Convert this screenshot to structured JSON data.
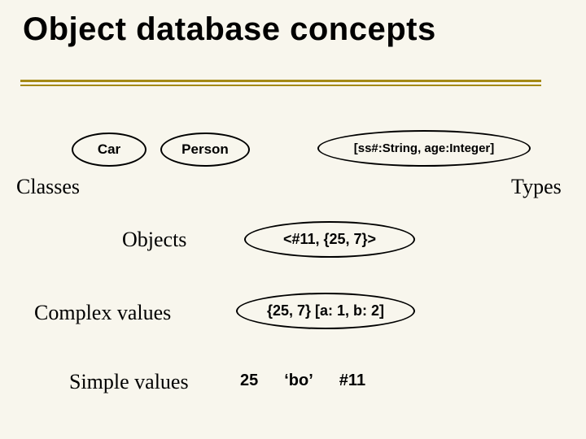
{
  "title": "Object database concepts",
  "classes": {
    "label": "Classes",
    "car": "Car",
    "person": "Person"
  },
  "types": {
    "label": "Types",
    "schema": "[ss#:String, age:Integer]"
  },
  "objects": {
    "label": "Objects",
    "example": "<#11, {25, 7}>"
  },
  "complex_values": {
    "label": "Complex values",
    "example": "{25, 7} [a: 1, b: 2]"
  },
  "simple_values": {
    "label": "Simple values",
    "v1": "25",
    "v2": "‘bo’",
    "v3": "#11"
  }
}
